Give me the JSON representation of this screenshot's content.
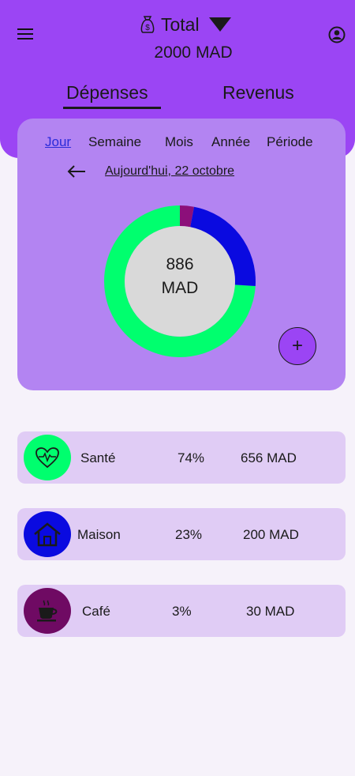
{
  "header": {
    "total_label": "Total",
    "total_amount": "2000 MAD",
    "tabs": [
      {
        "label": "Dépenses",
        "active": true
      },
      {
        "label": "Revenus",
        "active": false
      }
    ],
    "accent_color": "#9b45f4"
  },
  "periods": [
    {
      "label": "Jour",
      "active": true
    },
    {
      "label": "Semaine",
      "active": false
    },
    {
      "label": "Mois",
      "active": false
    },
    {
      "label": "Année",
      "active": false
    },
    {
      "label": "Période",
      "active": false
    }
  ],
  "date_label": "Aujourd'hui, 22 octobre",
  "summary": {
    "amount": "886",
    "currency": "MAD"
  },
  "chart_data": {
    "type": "pie",
    "categories": [
      "Santé",
      "Maison",
      "Café"
    ],
    "values": [
      74,
      23,
      3
    ],
    "colors": [
      "#00ff6e",
      "#0a0ae0",
      "#8c0f7a"
    ]
  },
  "add_button_label": "+",
  "categories": [
    {
      "icon": "heart-pulse-icon",
      "name": "Santé",
      "percent": "74%",
      "amount": "656 MAD",
      "color": "#00ff6e"
    },
    {
      "icon": "house-icon",
      "name": "Maison",
      "percent": "23%",
      "amount": "200 MAD",
      "color": "#0a0ae0"
    },
    {
      "icon": "coffee-cup-icon",
      "name": "Café",
      "percent": "3%",
      "amount": "30 MAD",
      "color": "#6f0a63"
    }
  ]
}
